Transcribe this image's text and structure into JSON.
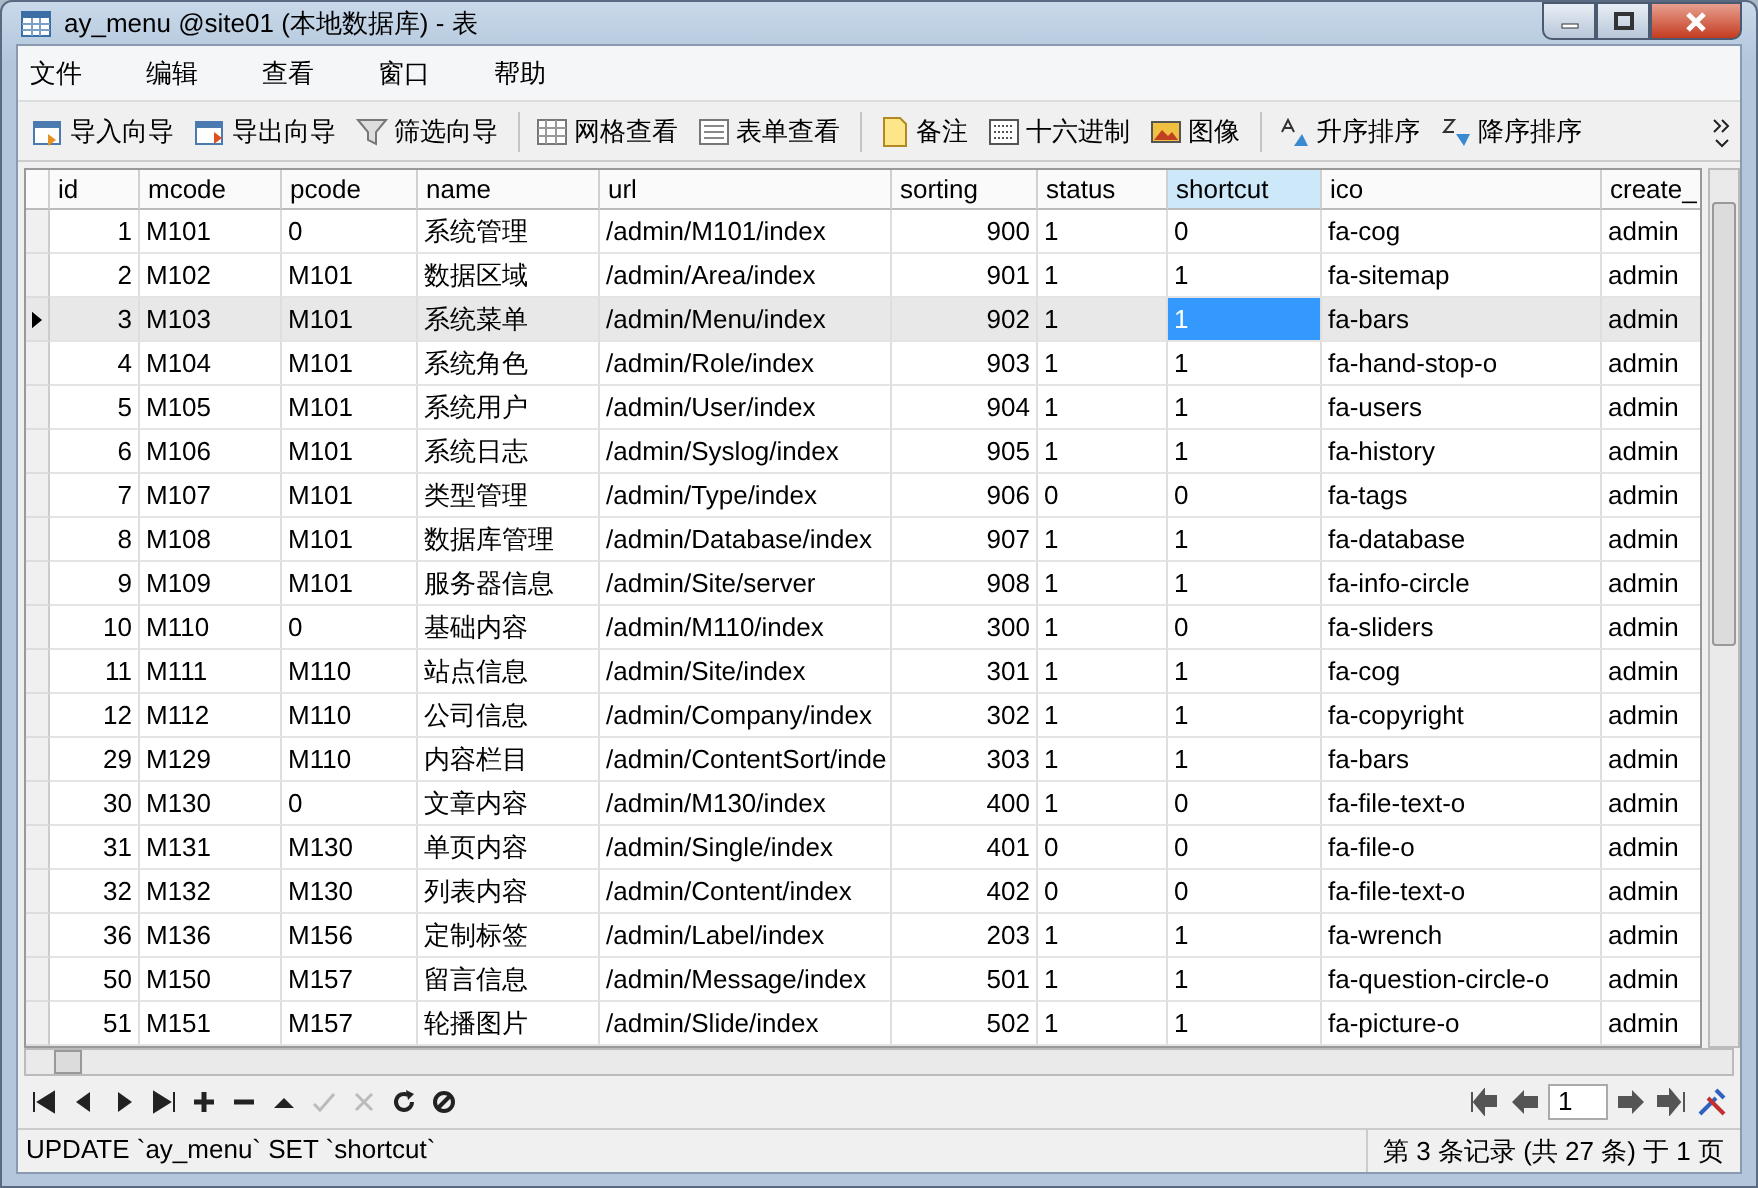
{
  "window": {
    "title": "ay_menu @site01 (本地数据库) - 表"
  },
  "menu": [
    "文件",
    "编辑",
    "查看",
    "窗口",
    "帮助"
  ],
  "toolbar": [
    {
      "label": "导入向导",
      "kind": "import"
    },
    {
      "label": "导出向导",
      "kind": "export"
    },
    {
      "label": "筛选向导",
      "kind": "filter"
    },
    {
      "label": "网格查看",
      "kind": "grid",
      "sep": true
    },
    {
      "label": "表单查看",
      "kind": "form"
    },
    {
      "label": "备注",
      "kind": "note",
      "sep": true
    },
    {
      "label": "十六进制",
      "kind": "hex"
    },
    {
      "label": "图像",
      "kind": "image"
    },
    {
      "label": "升序排序",
      "kind": "asc",
      "sep": true
    },
    {
      "label": "降序排序",
      "kind": "desc"
    }
  ],
  "table": {
    "columns": [
      {
        "label": "id",
        "selected": false
      },
      {
        "label": "mcode",
        "selected": false
      },
      {
        "label": "pcode",
        "selected": false
      },
      {
        "label": "name",
        "selected": false
      },
      {
        "label": "url",
        "selected": false
      },
      {
        "label": "sorting",
        "selected": false
      },
      {
        "label": "status",
        "selected": false
      },
      {
        "label": "shortcut",
        "selected": true
      },
      {
        "label": "ico",
        "selected": false
      },
      {
        "label": "create_",
        "selected": false
      }
    ],
    "rows": [
      {
        "selected": false,
        "cells": [
          "1",
          "M101",
          "0",
          "系统管理",
          "/admin/M101/index",
          "900",
          "1",
          "0",
          "fa-cog",
          "admin"
        ]
      },
      {
        "selected": false,
        "cells": [
          "2",
          "M102",
          "M101",
          "数据区域",
          "/admin/Area/index",
          "901",
          "1",
          "1",
          "fa-sitemap",
          "admin"
        ]
      },
      {
        "selected": true,
        "cells": [
          "3",
          "M103",
          "M101",
          "系统菜单",
          "/admin/Menu/index",
          "902",
          "1",
          "1",
          "fa-bars",
          "admin"
        ]
      },
      {
        "selected": false,
        "cells": [
          "4",
          "M104",
          "M101",
          "系统角色",
          "/admin/Role/index",
          "903",
          "1",
          "1",
          "fa-hand-stop-o",
          "admin"
        ]
      },
      {
        "selected": false,
        "cells": [
          "5",
          "M105",
          "M101",
          "系统用户",
          "/admin/User/index",
          "904",
          "1",
          "1",
          "fa-users",
          "admin"
        ]
      },
      {
        "selected": false,
        "cells": [
          "6",
          "M106",
          "M101",
          "系统日志",
          "/admin/Syslog/index",
          "905",
          "1",
          "1",
          "fa-history",
          "admin"
        ]
      },
      {
        "selected": false,
        "cells": [
          "7",
          "M107",
          "M101",
          "类型管理",
          "/admin/Type/index",
          "906",
          "0",
          "0",
          "fa-tags",
          "admin"
        ]
      },
      {
        "selected": false,
        "cells": [
          "8",
          "M108",
          "M101",
          "数据库管理",
          "/admin/Database/index",
          "907",
          "1",
          "1",
          "fa-database",
          "admin"
        ]
      },
      {
        "selected": false,
        "cells": [
          "9",
          "M109",
          "M101",
          "服务器信息",
          "/admin/Site/server",
          "908",
          "1",
          "1",
          "fa-info-circle",
          "admin"
        ]
      },
      {
        "selected": false,
        "cells": [
          "10",
          "M110",
          "0",
          "基础内容",
          "/admin/M110/index",
          "300",
          "1",
          "0",
          "fa-sliders",
          "admin"
        ]
      },
      {
        "selected": false,
        "cells": [
          "11",
          "M111",
          "M110",
          "站点信息",
          "/admin/Site/index",
          "301",
          "1",
          "1",
          "fa-cog",
          "admin"
        ]
      },
      {
        "selected": false,
        "cells": [
          "12",
          "M112",
          "M110",
          "公司信息",
          "/admin/Company/index",
          "302",
          "1",
          "1",
          "fa-copyright",
          "admin"
        ]
      },
      {
        "selected": false,
        "cells": [
          "29",
          "M129",
          "M110",
          "内容栏目",
          "/admin/ContentSort/inde",
          "303",
          "1",
          "1",
          "fa-bars",
          "admin"
        ]
      },
      {
        "selected": false,
        "cells": [
          "30",
          "M130",
          "0",
          "文章内容",
          "/admin/M130/index",
          "400",
          "1",
          "0",
          "fa-file-text-o",
          "admin"
        ]
      },
      {
        "selected": false,
        "cells": [
          "31",
          "M131",
          "M130",
          "单页内容",
          "/admin/Single/index",
          "401",
          "0",
          "0",
          "fa-file-o",
          "admin"
        ]
      },
      {
        "selected": false,
        "cells": [
          "32",
          "M132",
          "M130",
          "列表内容",
          "/admin/Content/index",
          "402",
          "0",
          "0",
          "fa-file-text-o",
          "admin"
        ]
      },
      {
        "selected": false,
        "cells": [
          "36",
          "M136",
          "M156",
          "定制标签",
          "/admin/Label/index",
          "203",
          "1",
          "1",
          "fa-wrench",
          "admin"
        ]
      },
      {
        "selected": false,
        "cells": [
          "50",
          "M150",
          "M157",
          "留言信息",
          "/admin/Message/index",
          "501",
          "1",
          "1",
          "fa-question-circle-o",
          "admin"
        ]
      },
      {
        "selected": false,
        "cells": [
          "51",
          "M151",
          "M157",
          "轮播图片",
          "/admin/Slide/index",
          "502",
          "1",
          "1",
          "fa-picture-o",
          "admin"
        ]
      }
    ]
  },
  "pager": {
    "page": "1"
  },
  "status_bar": {
    "sql": "UPDATE `ay_menu` SET `shortcut`",
    "record": "第 3 条记录 (共 27 条) 于 1 页"
  }
}
